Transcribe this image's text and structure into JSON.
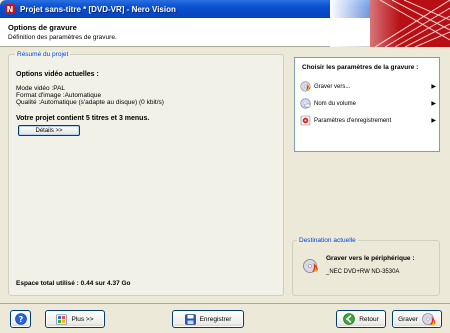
{
  "window": {
    "title": "Projet sans-titre * [DVD-VR] - Nero Vision"
  },
  "header": {
    "title": "Options de gravure",
    "subtitle": "Définition des paramètres de gravure."
  },
  "summary": {
    "group_label": "Résumé du projet",
    "options_title": "Options vidéo actuelles :",
    "video_mode": "Mode vidéo :PAL",
    "image_format": "Format d'image :Automatique",
    "quality": "Qualité :Automatique (s'adapte au disque) (0 kbit/s)",
    "project_contents": "Votre projet contient 5 titres et 3 menus.",
    "details_label": "Détails >>",
    "space_used": "Espace total utilisé : 0.44 sur 4.37 Go"
  },
  "choices": {
    "title": "Choisir les paramètres de la gravure :",
    "items": [
      {
        "label": "Graver vers...",
        "icon": "burn-icon"
      },
      {
        "label": "Nom du volume",
        "icon": "disc-name-icon"
      },
      {
        "label": "Paramètres d'enregistrement",
        "icon": "settings-icon"
      }
    ]
  },
  "destination": {
    "group_label": "Destination actuelle",
    "title": "Graver vers le périphérique :",
    "device": "_NEC    DVD+RW ND-3530A"
  },
  "footer": {
    "help_icon": "help-icon",
    "plus_label": "Plus >>",
    "save_label": "Enregistrer",
    "back_label": "Retour",
    "burn_label": "Graver"
  }
}
